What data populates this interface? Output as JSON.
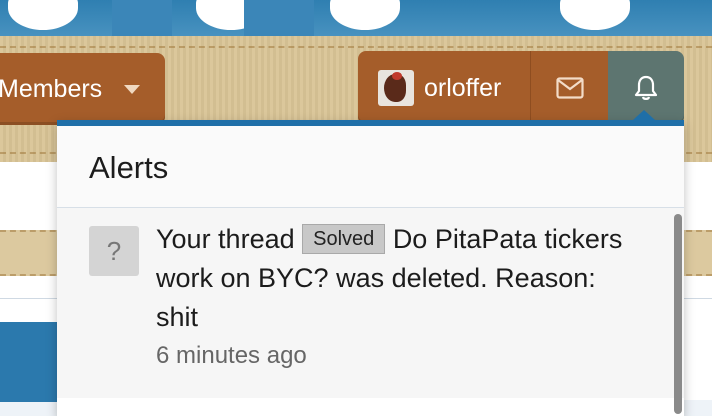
{
  "nav": {
    "members_label": "Members",
    "username": "orloffer"
  },
  "alerts": {
    "title": "Alerts",
    "items": [
      {
        "icon_glyph": "?",
        "text_before": "Your thread",
        "badge": "Solved",
        "text_after": "Do PitaPata tickers work on BYC? was deleted. Reason: shit",
        "time": "6 minutes ago"
      }
    ]
  },
  "colors": {
    "nav_button": "#a55d2a",
    "bell_active": "#5d7570",
    "menu_accent": "#1f6fa8"
  },
  "icons": {
    "members_dropdown": "chevron-down-icon",
    "mail": "envelope-icon",
    "bell": "bell-icon"
  }
}
